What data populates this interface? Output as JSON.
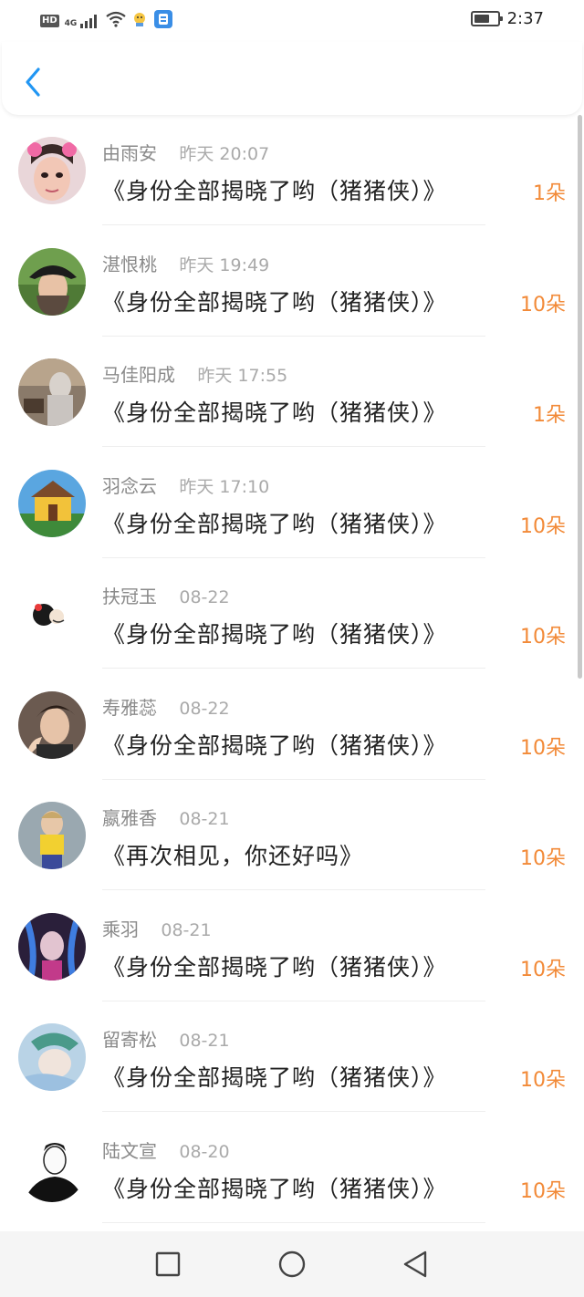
{
  "status_bar": {
    "time": "2:37",
    "hd": "HD",
    "network": "4G",
    "icons": [
      "hd-icon",
      "signal-icon",
      "wifi-icon",
      "app-notification-icon",
      "shield-app-icon",
      "battery-icon"
    ]
  },
  "header": {
    "back_icon": "chevron-left-icon",
    "accent_color": "#2196f3"
  },
  "colors": {
    "amount": "#f28a38",
    "name": "#8a8a8a",
    "time": "#aaaaaa"
  },
  "list": [
    {
      "name": "由雨安",
      "time": "昨天 20:07",
      "title": "《身份全部揭晓了哟（猪猪侠）》",
      "amount": "1朵"
    },
    {
      "name": "湛恨桃",
      "time": "昨天 19:49",
      "title": "《身份全部揭晓了哟（猪猪侠）》",
      "amount": "10朵"
    },
    {
      "name": "马佳阳成",
      "time": "昨天 17:55",
      "title": "《身份全部揭晓了哟（猪猪侠）》",
      "amount": "1朵"
    },
    {
      "name": "羽念云",
      "time": "昨天 17:10",
      "title": "《身份全部揭晓了哟（猪猪侠）》",
      "amount": "10朵"
    },
    {
      "name": "扶冠玉",
      "time": "08-22",
      "title": "《身份全部揭晓了哟（猪猪侠）》",
      "amount": "10朵"
    },
    {
      "name": "寿雅蕊",
      "time": "08-22",
      "title": "《身份全部揭晓了哟（猪猪侠）》",
      "amount": "10朵"
    },
    {
      "name": "嬴雅香",
      "time": "08-21",
      "title": "《再次相见，你还好吗》",
      "amount": "10朵"
    },
    {
      "name": "乘羽",
      "time": "08-21",
      "title": "《身份全部揭晓了哟（猪猪侠）》",
      "amount": "10朵"
    },
    {
      "name": "留寄松",
      "time": "08-21",
      "title": "《身份全部揭晓了哟（猪猪侠）》",
      "amount": "10朵"
    },
    {
      "name": "陆文宣",
      "time": "08-20",
      "title": "《身份全部揭晓了哟（猪猪侠）》",
      "amount": "10朵"
    }
  ],
  "navbar": {
    "icons": [
      "recent-apps-icon",
      "home-icon",
      "back-icon"
    ]
  }
}
